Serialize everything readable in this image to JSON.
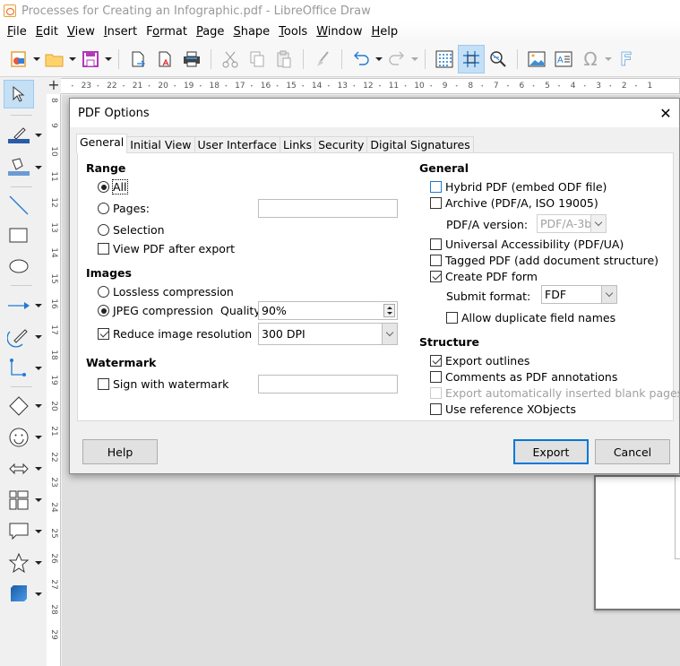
{
  "window": {
    "title": "Processes for Creating an Infographic.pdf - LibreOffice Draw"
  },
  "menubar": {
    "items": [
      {
        "label": "File",
        "accel": "F"
      },
      {
        "label": "Edit",
        "accel": "E"
      },
      {
        "label": "View",
        "accel": "V"
      },
      {
        "label": "Insert",
        "accel": "I"
      },
      {
        "label": "Format",
        "accel": "o"
      },
      {
        "label": "Page",
        "accel": "P"
      },
      {
        "label": "Shape",
        "accel": "S"
      },
      {
        "label": "Tools",
        "accel": "T"
      },
      {
        "label": "Window",
        "accel": "W"
      },
      {
        "label": "Help",
        "accel": "H"
      }
    ]
  },
  "toolbar": {
    "icons": [
      "new-document",
      "open-folder",
      "save",
      "export",
      "export-pdf",
      "print",
      "cut",
      "copy",
      "paste",
      "clone-formatting",
      "undo",
      "redo",
      "show-grid",
      "snap-to-grid",
      "zoom-pan",
      "insert-image",
      "insert-text-box",
      "special-character",
      "fontwork"
    ]
  },
  "rulers": {
    "horizontal_labels": [
      "23",
      "22",
      "21",
      "20",
      "19",
      "18",
      "17",
      "16",
      "15",
      "14",
      "13",
      "12",
      "11",
      "10",
      "9",
      "8",
      "7",
      "6",
      "5",
      "4",
      "3",
      "2",
      "1"
    ],
    "vertical_labels": [
      "8",
      "9",
      "10",
      "11",
      "12",
      "13",
      "14",
      "15",
      "16",
      "17",
      "18",
      "19",
      "20",
      "21",
      "22",
      "23",
      "24",
      "25",
      "26",
      "27",
      "28",
      "29"
    ]
  },
  "sidebar": {
    "tools": [
      "select",
      "line-color",
      "fill-color",
      "line",
      "rectangle",
      "ellipse",
      "line-arrow",
      "curve",
      "connector",
      "basic-shapes",
      "symbol-shapes",
      "block-arrows",
      "flowchart",
      "callouts",
      "stars",
      "3d-objects"
    ]
  },
  "dialog": {
    "title": "PDF Options",
    "tabs": [
      "General",
      "Initial View",
      "User Interface",
      "Links",
      "Security",
      "Digital Signatures"
    ],
    "active_tab": "General",
    "range": {
      "title": "Range",
      "all": "All",
      "pages": "Pages:",
      "pages_value": "",
      "selection": "Selection",
      "view_after_export": "View PDF after export",
      "selected": "All",
      "view_after_export_checked": false
    },
    "images": {
      "title": "Images",
      "lossless": "Lossless compression",
      "jpeg": "JPEG compression",
      "quality_label": "Quality:",
      "quality_value": "90%",
      "reduce_resolution": "Reduce image resolution",
      "reduce_resolution_checked": true,
      "resolution_value": "300 DPI"
    },
    "watermark": {
      "title": "Watermark",
      "sign": "Sign with watermark",
      "sign_checked": false,
      "text_value": ""
    },
    "general": {
      "title": "General",
      "hybrid": "Hybrid PDF (embed ODF file)",
      "archive": "Archive (PDF/A, ISO 19005)",
      "pdfa_version_label": "PDF/A version:",
      "pdfa_version_value": "PDF/A-3b",
      "universal_accessibility": "Universal Accessibility (PDF/UA)",
      "tagged": "Tagged PDF (add document structure)",
      "create_form": "Create PDF form",
      "create_form_checked": true,
      "submit_format_label": "Submit format:",
      "submit_format_value": "FDF",
      "allow_duplicate": "Allow duplicate field names"
    },
    "structure": {
      "title": "Structure",
      "export_outlines": "Export outlines",
      "export_outlines_checked": true,
      "comments": "Comments as PDF annotations",
      "blank_pages": "Export automatically inserted blank pages",
      "reference_xobjects": "Use reference XObjects"
    },
    "buttons": {
      "help": "Help",
      "export": "Export",
      "cancel": "Cancel"
    }
  }
}
